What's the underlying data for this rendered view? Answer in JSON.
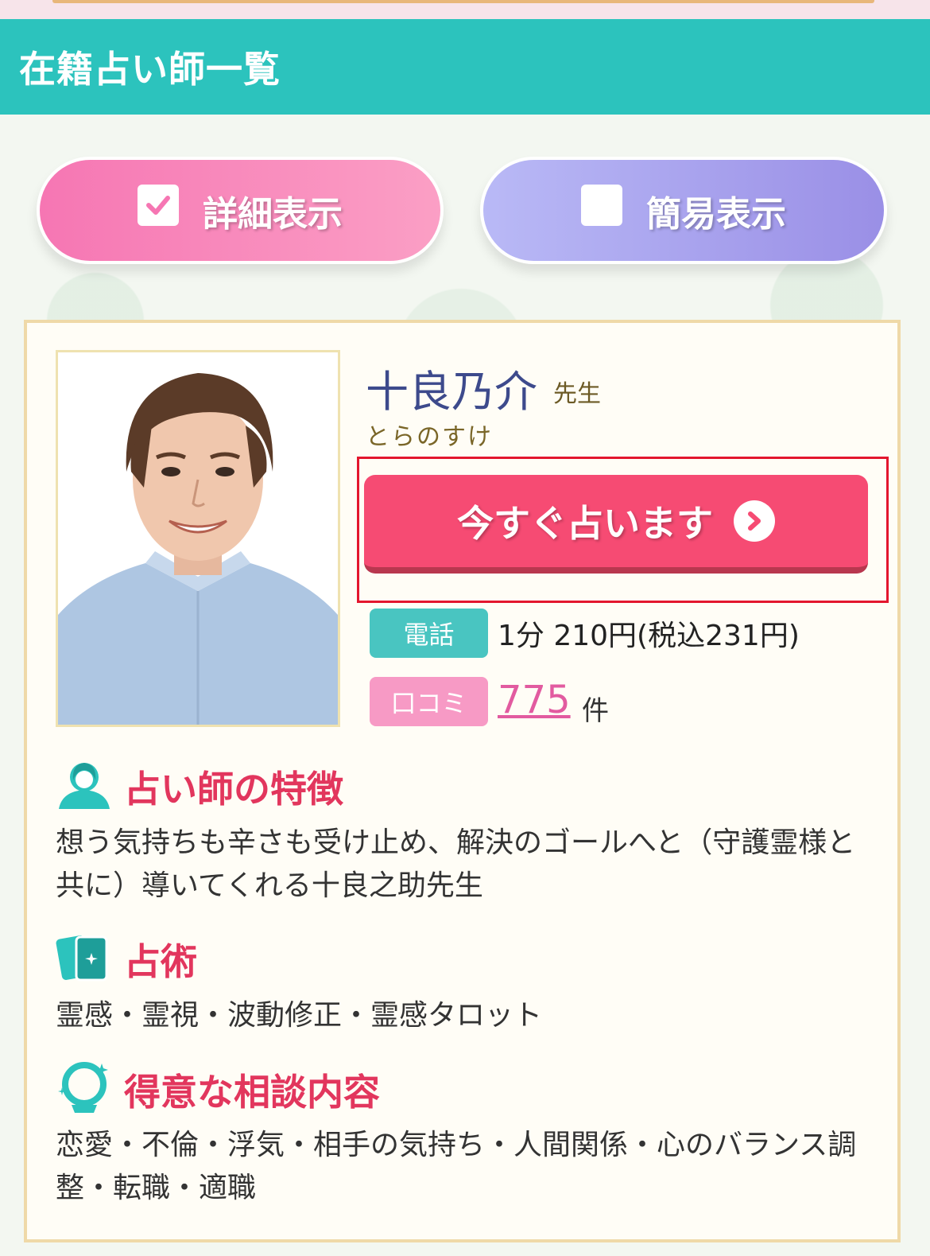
{
  "header": {
    "title": "在籍占い師一覧"
  },
  "view_toggle": {
    "detail_label": "詳細表示",
    "simple_label": "簡易表示",
    "selected": "詳細表示"
  },
  "profile": {
    "name": "十良乃介",
    "honorific": "先生",
    "reading": "とらのすけ",
    "cta_label": "今すぐ占います",
    "phone_badge": "電話",
    "price": "1分 210円(税込231円)",
    "review_badge": "口コミ",
    "review_count": "775",
    "review_unit": "件"
  },
  "sections": {
    "features_title": "占い師の特徴",
    "features_text": "想う気持ちも辛さも受け止め、解決のゴールへと（守護霊様と共に）導いてくれる十良之助先生",
    "methods_title": "占術",
    "methods_text": "霊感・霊視・波動修正・霊感タロット",
    "topics_title": "得意な相談内容",
    "topics_text": "恋愛・不倫・浮気・相手の気持ち・人間関係・心のバランス調整・転職・適職"
  },
  "colors": {
    "header_bg": "#2cc3bd",
    "cta_bg": "#f64b73",
    "highlight_border": "#e3162e",
    "section_title": "#e2365d"
  }
}
